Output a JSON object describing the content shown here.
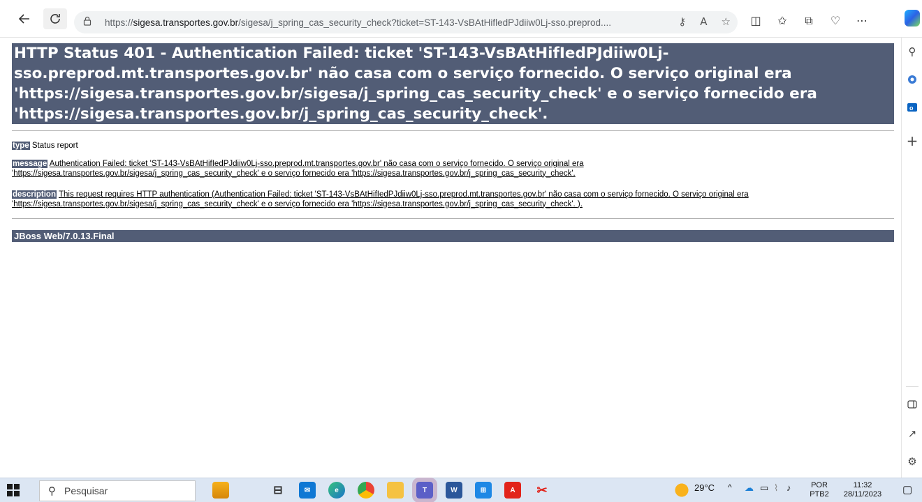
{
  "browser": {
    "url_prefix": "https://",
    "url_host": "sigesa.transportes.gov.br",
    "url_path": "/sigesa/j_spring_cas_security_check?ticket=ST-143-VsBAtHifledPJdiiw0Lj-sso.preprod...."
  },
  "page": {
    "title": "HTTP Status 401 - Authentication Failed: ticket 'ST-143-VsBAtHifIedPJdiiw0Lj-sso.preprod.mt.transportes.gov.br' não casa com o serviço fornecido. O serviço original era 'https://sigesa.transportes.gov.br/sigesa/j_spring_cas_security_check' e o serviço fornecido era 'https://sigesa.transportes.gov.br/j_spring_cas_security_check'.",
    "type_label": "type",
    "type_value": "Status report",
    "message_label": "message",
    "message_line1": "Authentication Failed: ticket 'ST-143-VsBAtHifIedPJdiiw0Lj-sso.preprod.mt.transportes.gov.br' não casa com o serviço fornecido. O serviço original era",
    "message_line2": "'https://sigesa.transportes.gov.br/sigesa/j_spring_cas_security_check' e o serviço fornecido era 'https://sigesa.transportes.gov.br/j_spring_cas_security_check'.",
    "description_label": "description",
    "description_line1": "This request requires HTTP authentication (Authentication Failed: ticket 'ST-143-VsBAtHifIedPJdiiw0Lj-sso.preprod.mt.transportes.gov.br' não casa com o serviço fornecido. O serviço original era",
    "description_line2": "'https://sigesa.transportes.gov.br/sigesa/j_spring_cas_security_check' e o serviço fornecido era 'https://sigesa.transportes.gov.br/j_spring_cas_security_check'. ).",
    "footer": "JBoss Web/7.0.13.Final"
  },
  "taskbar": {
    "search_placeholder": "Pesquisar",
    "temperature": "29°C",
    "language_top": "POR",
    "language_bottom": "PTB2",
    "time": "11:32",
    "date": "28/11/2023"
  },
  "colors": {
    "header_bg": "#525D76"
  }
}
